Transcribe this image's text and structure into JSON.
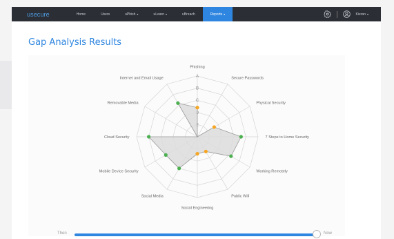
{
  "navbar": {
    "brand": "usecure",
    "items": [
      {
        "label": "Home",
        "dropdown": false,
        "active": false
      },
      {
        "label": "Users",
        "dropdown": false,
        "active": false
      },
      {
        "label": "uPhish",
        "dropdown": true,
        "active": false
      },
      {
        "label": "uLearn",
        "dropdown": true,
        "active": false
      },
      {
        "label": "uBreach",
        "dropdown": false,
        "active": false
      },
      {
        "label": "Reports",
        "dropdown": true,
        "active": true
      }
    ],
    "settings_icon": "gear-icon",
    "user_icon": "user-circle-icon",
    "user_name": "Kieran"
  },
  "page": {
    "title": "Gap Analysis Results"
  },
  "chart_data": {
    "type": "radar",
    "axes": [
      "Phishing",
      "Secure Passwords",
      "Physical Security",
      "7 Steps to Home Security",
      "Working Remotely",
      "Public Wifi",
      "Social Engineering",
      "Social Media",
      "Mobile Device Security",
      "Cloud Security",
      "Removable Media",
      "Internet and Email Usage"
    ],
    "levels": [
      "E",
      "D",
      "C",
      "B",
      "A"
    ],
    "values": [
      2.4,
      0,
      1.6,
      3.6,
      3.2,
      1.4,
      1.4,
      3,
      3,
      4,
      0,
      3.2
    ],
    "point_colors": [
      "#f5a623",
      "none",
      "#f5a623",
      "#4caf50",
      "#4caf50",
      "#f5a623",
      "#f5a623",
      "#4caf50",
      "#4caf50",
      "#4caf50",
      "none",
      "#4caf50"
    ],
    "fill": "#dcdcdc",
    "grid": true
  },
  "slider": {
    "left_label": "Then",
    "right_label": "Now",
    "value": 1.0
  }
}
